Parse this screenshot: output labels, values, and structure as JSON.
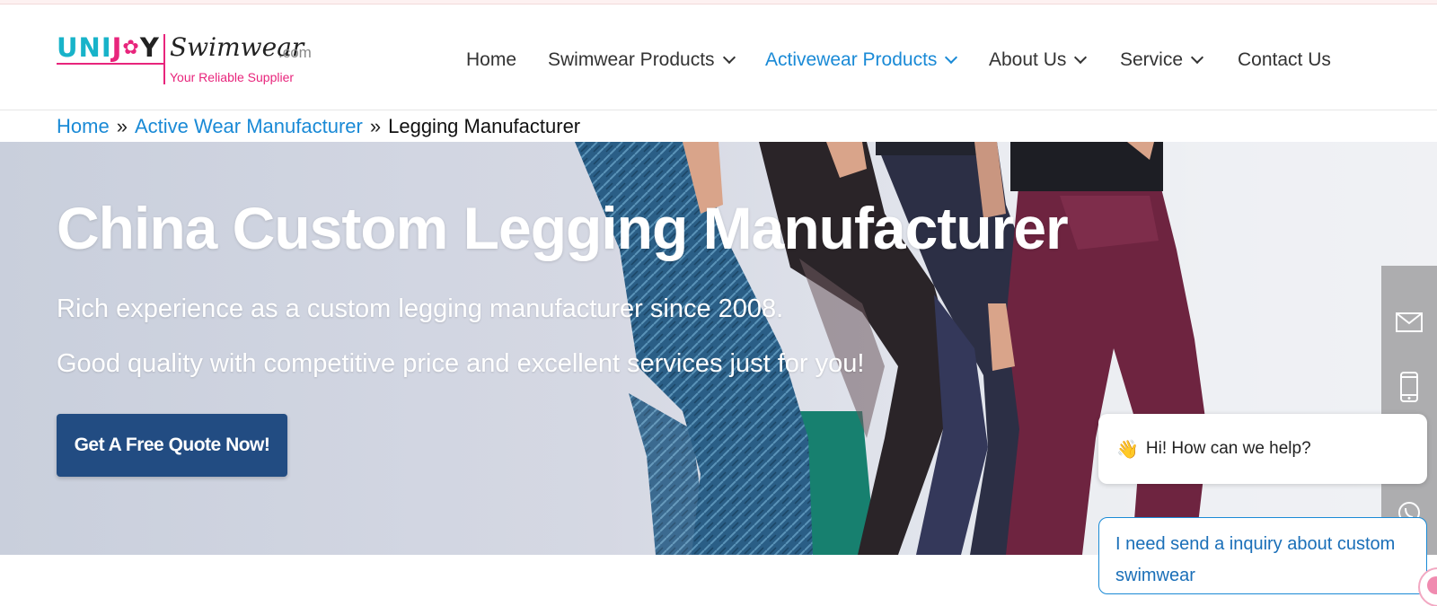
{
  "logo": {
    "brand_u": "UNI",
    "brand_j": "J",
    "brand_o": "✿",
    "brand_y": "Y",
    "swim": "Swimwear",
    "com": ".com",
    "tagline": "Your Reliable Supplier"
  },
  "nav": {
    "items": [
      {
        "label": "Home"
      },
      {
        "label": "Swimwear Products"
      },
      {
        "label": "Activewear Products"
      },
      {
        "label": "About Us"
      },
      {
        "label": "Service"
      },
      {
        "label": "Contact Us"
      }
    ],
    "active_color": "#1a8ad6"
  },
  "breadcrumb": {
    "items": [
      "Home",
      "Active Wear Manufacturer",
      "Legging Manufacturer"
    ],
    "separator": "»"
  },
  "hero": {
    "title": "China Custom Legging Manufacturer",
    "line1": "Rich experience as a custom legging manufacturer since 2008.",
    "line2": "Good quality with competitive price and excellent services just for you!",
    "cta_label": "Get A Free Quote Now!",
    "cta_color": "#224c82"
  },
  "sidebar": {
    "icons": [
      "mail-icon",
      "phone-icon",
      "whatsapp-icon"
    ]
  },
  "chat": {
    "wave_emoji": "👋",
    "greeting": "Hi! How can we help?",
    "inquiry": "I need send a inquiry about custom swimwear"
  }
}
